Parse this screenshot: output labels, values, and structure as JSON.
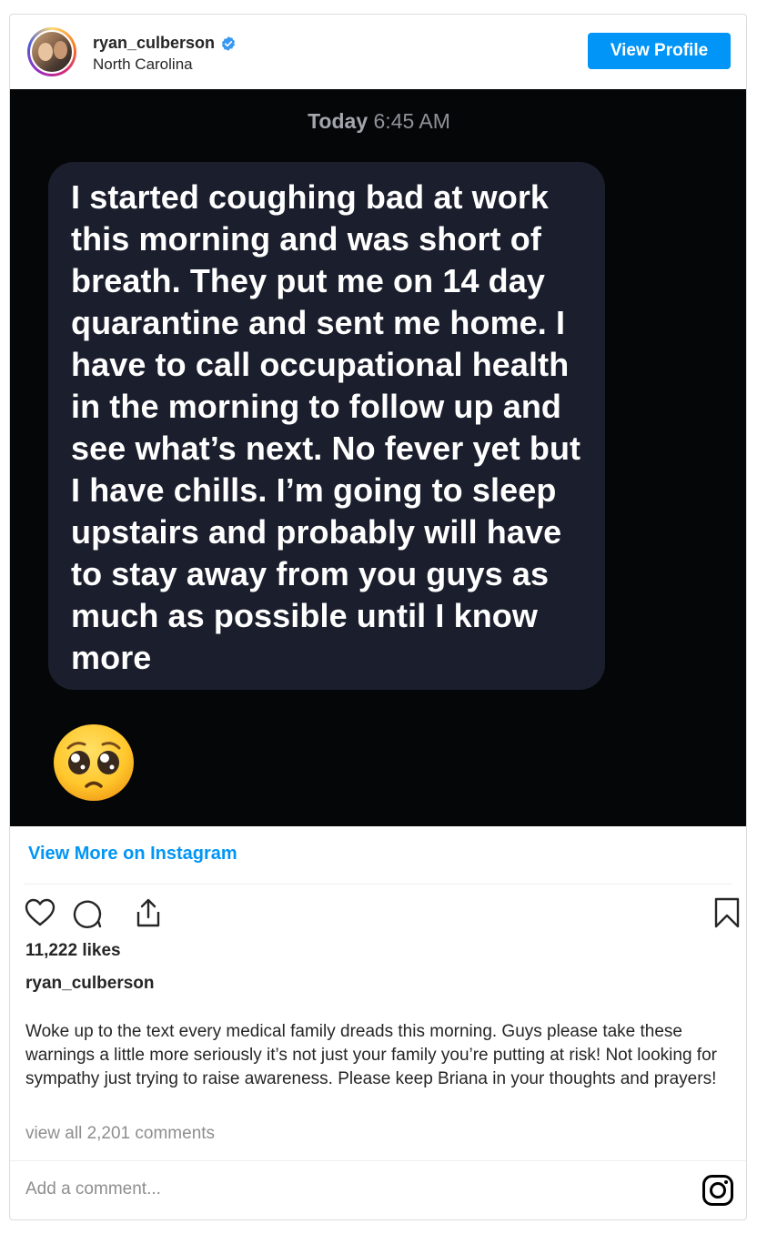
{
  "header": {
    "username": "ryan_culberson",
    "location": "North Carolina",
    "view_profile_label": "View Profile",
    "verified_icon": "verified-badge-icon",
    "accent": "#0095f6"
  },
  "media": {
    "timestamp_day": "Today",
    "timestamp_time": "6:45 AM",
    "message": "I started coughing bad at work this morning and was short of breath. They put me on 14 day quarantine and sent me home. I have to call occupational health in the morning to follow up and see what’s next. No fever yet but I have chills. I’m going to sleep upstairs and probably will have to stay away from you guys as much as possible until I know more",
    "emoji": "pleading-face-emoji"
  },
  "view_more_label": "View More on Instagram",
  "actions": {
    "like_icon": "heart-icon",
    "comment_icon": "comment-icon",
    "share_icon": "share-icon",
    "save_icon": "bookmark-icon"
  },
  "likes": "11,222 likes",
  "post": {
    "username": "ryan_culberson",
    "caption": "Woke up to the text every medical family dreads this morning. Guys please take these warnings a little more seriously it’s not just your family you’re putting at risk! Not looking for sympathy just trying to raise awareness. Please keep Briana in your thoughts and prayers!",
    "comments_link": "view all 2,201 comments"
  },
  "comment_box": {
    "placeholder": "Add a comment...",
    "logo_icon": "instagram-icon"
  }
}
